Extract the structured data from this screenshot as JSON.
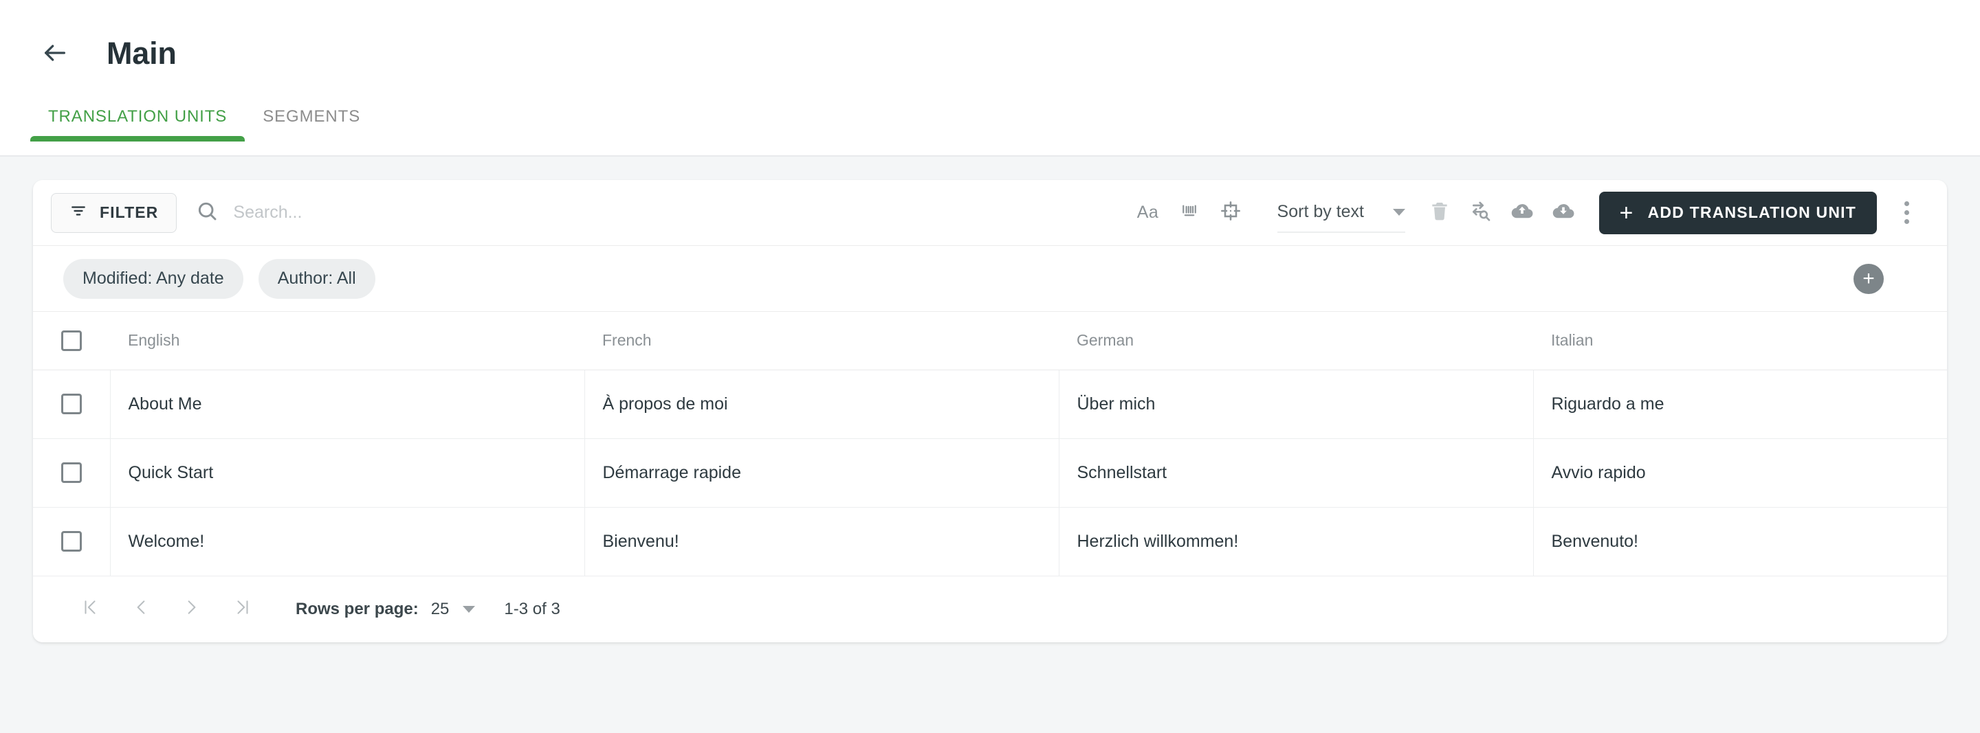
{
  "header": {
    "back_icon": "arrow-left-icon",
    "title": "Main",
    "tabs": [
      {
        "label": "TRANSLATION UNITS",
        "active": true
      },
      {
        "label": "SEGMENTS",
        "active": false
      }
    ]
  },
  "toolbar": {
    "filter_label": "FILTER",
    "filter_icon": "filter-list-icon",
    "search_icon": "search-icon",
    "search_value": "",
    "search_placeholder": "Search...",
    "match_case_label": "Aa",
    "whole_word_icon": "whole-word-icon",
    "regex_icon": "regex-crosshair-icon",
    "sort_label": "Sort by text",
    "delete_icon": "trash-icon",
    "find_replace_icon": "find-replace-icon",
    "upload_icon": "cloud-upload-icon",
    "download_icon": "cloud-download-icon",
    "add_label": "ADD TRANSLATION UNIT",
    "add_plus": "+",
    "more_icon": "more-vertical-icon"
  },
  "filters": {
    "chips": [
      {
        "label": "Modified: Any date"
      },
      {
        "label": "Author: All"
      }
    ],
    "add_chip_icon": "plus-circle-icon",
    "add_chip_glyph": "+"
  },
  "table": {
    "columns": [
      "English",
      "French",
      "German",
      "Italian"
    ],
    "rows": [
      {
        "English": "About Me",
        "French": "À propos de moi",
        "German": "Über mich",
        "Italian": "Riguardo a me"
      },
      {
        "English": "Quick Start",
        "French": "Démarrage rapide",
        "German": "Schnellstart",
        "Italian": "Avvio rapido"
      },
      {
        "English": "Welcome!",
        "French": "Bienvenu!",
        "German": "Herzlich willkommen!",
        "Italian": "Benvenuto!"
      }
    ]
  },
  "pagination": {
    "first_icon": "first-page-icon",
    "prev_icon": "prev-page-icon",
    "next_icon": "next-page-icon",
    "last_icon": "last-page-icon",
    "rows_per_page_label": "Rows per page:",
    "rows_per_page_value": "25",
    "range_label": "1-3 of 3"
  },
  "colors": {
    "accent_green": "#43a047",
    "dark_button": "#263238",
    "page_bg": "#f4f6f7",
    "muted_text": "#8a9094"
  }
}
